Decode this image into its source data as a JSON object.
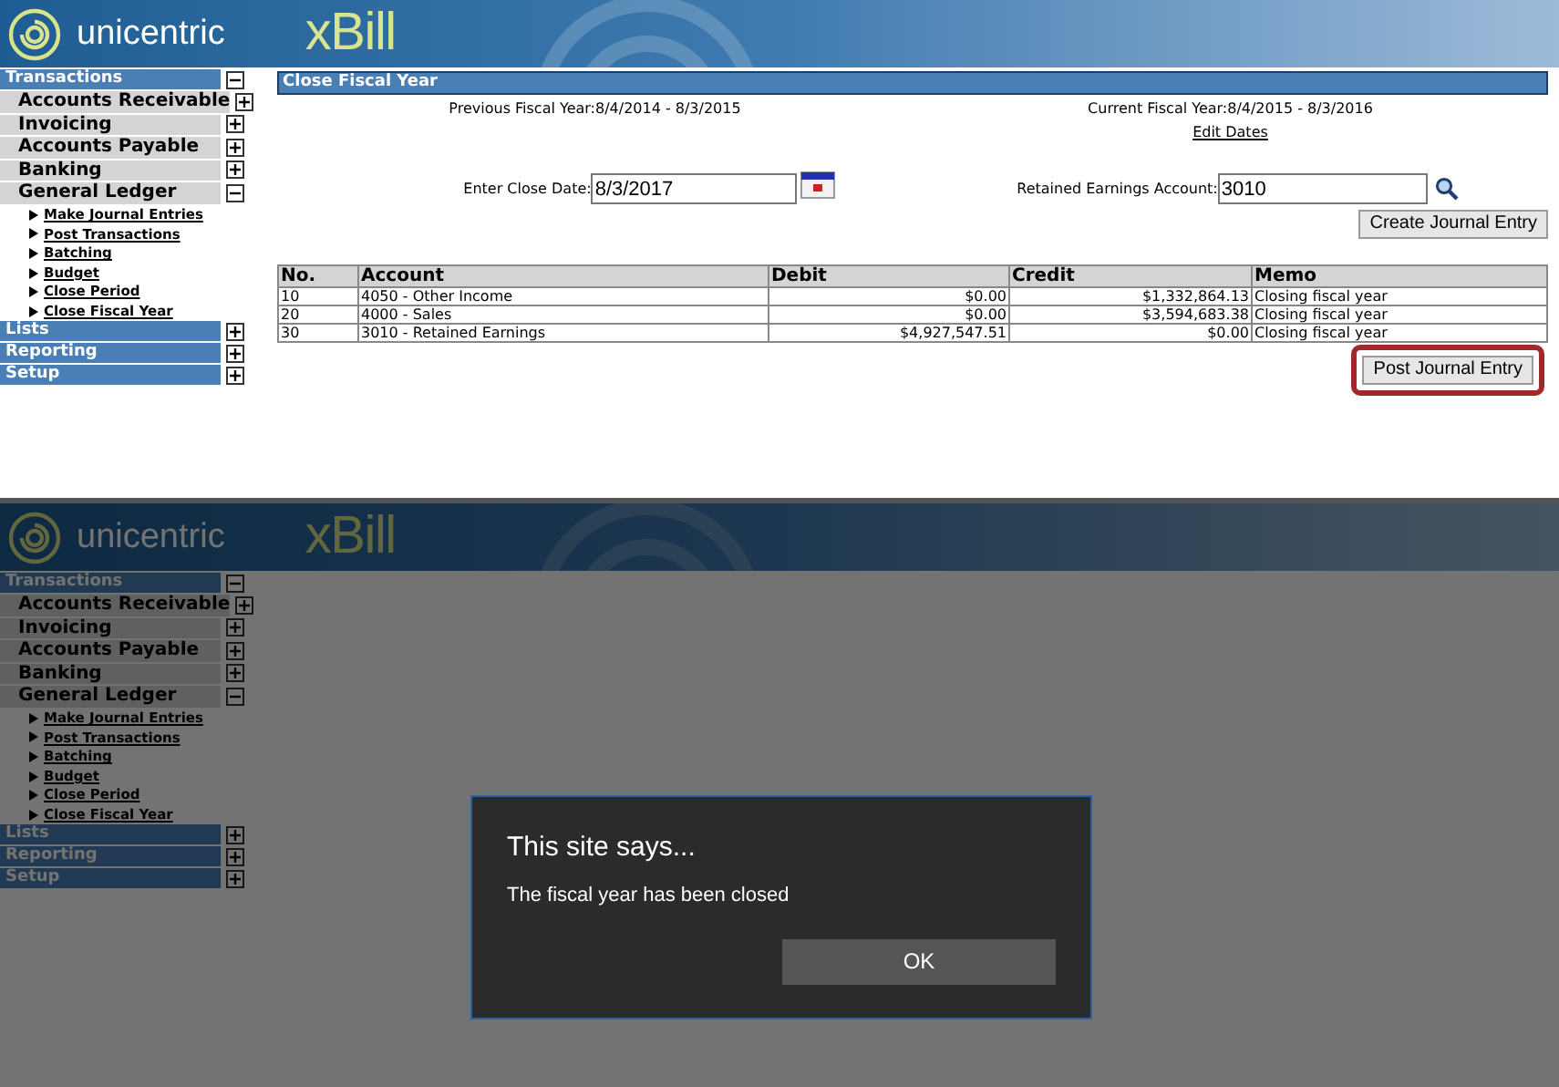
{
  "screens": [
    {
      "header": {
        "brand": "unicentric",
        "product": "xBill"
      },
      "sidebar": [
        {
          "label": "Transactions",
          "expanded": true,
          "children": [
            {
              "label": "Accounts Receivable",
              "expanded": false
            },
            {
              "label": "Invoicing",
              "expanded": false
            },
            {
              "label": "Accounts Payable",
              "expanded": false
            },
            {
              "label": "Banking",
              "expanded": false
            },
            {
              "label": "General Ledger",
              "expanded": true,
              "children": [
                {
                  "label": "Make Journal Entries"
                },
                {
                  "label": "Post Transactions"
                },
                {
                  "label": "Batching"
                },
                {
                  "label": "Budget"
                },
                {
                  "label": "Close Period"
                },
                {
                  "label": "Close Fiscal Year"
                }
              ]
            }
          ]
        },
        {
          "label": "Lists",
          "expanded": false
        },
        {
          "label": "Reporting",
          "expanded": false
        },
        {
          "label": "Setup",
          "expanded": false
        }
      ],
      "main": {
        "title": "Close Fiscal Year",
        "previous_fiscal_year": "Previous Fiscal Year:8/4/2014 - 8/3/2015",
        "current_fiscal_year": "Current Fiscal Year:8/4/2015 - 8/3/2016",
        "edit_dates_link": "Edit Dates",
        "close_date": {
          "label": "Enter Close Date:",
          "value": "8/3/2017"
        },
        "retained_earnings": {
          "label": "Retained Earnings Account:",
          "value": "3010"
        },
        "create_button": "Create Journal Entry",
        "table": {
          "columns": [
            "No.",
            "Account",
            "Debit",
            "Credit",
            "Memo"
          ],
          "rows": [
            [
              "10",
              "4050 - Other Income",
              "$0.00",
              "$1,332,864.13",
              "Closing fiscal year"
            ],
            [
              "20",
              "4000 - Sales",
              "$0.00",
              "$3,594,683.38",
              "Closing fiscal year"
            ],
            [
              "30",
              "3010 - Retained Earnings",
              "$4,927,547.51",
              "$0.00",
              "Closing fiscal year"
            ]
          ]
        },
        "post_button": {
          "label": "Post Journal Entry",
          "highlighted": true
        }
      }
    },
    {
      "header": {
        "brand": "unicentric",
        "product": "xBill"
      },
      "sidebar": [
        {
          "label": "Transactions",
          "expanded": true,
          "children": [
            {
              "label": "Accounts Receivable",
              "expanded": false
            },
            {
              "label": "Invoicing",
              "expanded": false
            },
            {
              "label": "Accounts Payable",
              "expanded": false
            },
            {
              "label": "Banking",
              "expanded": false
            },
            {
              "label": "General Ledger",
              "expanded": true,
              "children": [
                {
                  "label": "Make Journal Entries"
                },
                {
                  "label": "Post Transactions"
                },
                {
                  "label": "Batching"
                },
                {
                  "label": "Budget"
                },
                {
                  "label": "Close Period"
                },
                {
                  "label": "Close Fiscal Year"
                }
              ]
            }
          ]
        },
        {
          "label": "Lists",
          "expanded": false
        },
        {
          "label": "Reporting",
          "expanded": false
        },
        {
          "label": "Setup",
          "expanded": false
        }
      ],
      "dialog": {
        "title": "This site says...",
        "message": "The fiscal year has been closed",
        "button": "OK"
      }
    }
  ]
}
